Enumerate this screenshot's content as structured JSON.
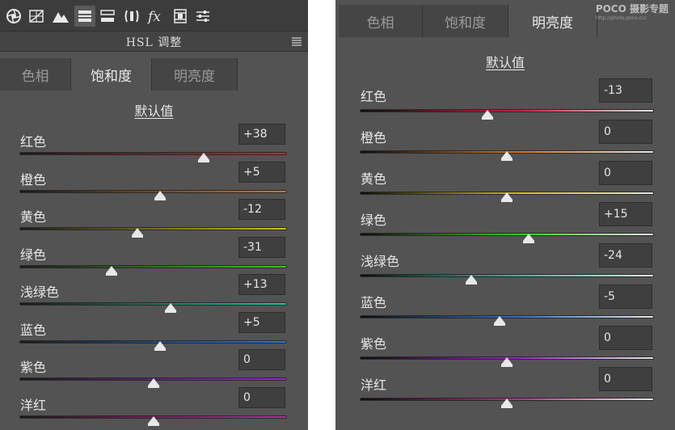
{
  "left": {
    "title": "HSL 调整",
    "tabs": [
      "色相",
      "饱和度",
      "明亮度"
    ],
    "active_tab": 1,
    "default_label": "默认值",
    "rows": [
      {
        "label": "红色",
        "value": "+38",
        "fraction": 0.69
      },
      {
        "label": "橙色",
        "value": "+5",
        "fraction": 0.525
      },
      {
        "label": "黄色",
        "value": "-12",
        "fraction": 0.44
      },
      {
        "label": "绿色",
        "value": "-31",
        "fraction": 0.345
      },
      {
        "label": "浅绿色",
        "value": "+13",
        "fraction": 0.565
      },
      {
        "label": "蓝色",
        "value": "+5",
        "fraction": 0.525
      },
      {
        "label": "紫色",
        "value": "0",
        "fraction": 0.5
      },
      {
        "label": "洋红",
        "value": "0",
        "fraction": 0.5
      }
    ]
  },
  "right": {
    "tabs": [
      "色相",
      "饱和度",
      "明亮度"
    ],
    "active_tab": 2,
    "logo_line1": "POCO 摄影专题",
    "logo_line2": "http://photo.poco.cn/",
    "default_label": "默认值",
    "rows": [
      {
        "label": "红色",
        "value": "-13",
        "fraction": 0.435
      },
      {
        "label": "橙色",
        "value": "0",
        "fraction": 0.5
      },
      {
        "label": "黄色",
        "value": "0",
        "fraction": 0.5
      },
      {
        "label": "绿色",
        "value": "+15",
        "fraction": 0.575
      },
      {
        "label": "浅绿色",
        "value": "-24",
        "fraction": 0.38
      },
      {
        "label": "蓝色",
        "value": "-5",
        "fraction": 0.475
      },
      {
        "label": "紫色",
        "value": "0",
        "fraction": 0.5
      },
      {
        "label": "洋红",
        "value": "0",
        "fraction": 0.5
      }
    ]
  },
  "colors": {
    "panel_bg": "#535353",
    "track_red": "#c8243c",
    "track_orange": "#d9731e",
    "track_yellow": "#cfc21a",
    "track_green": "#3ec81e",
    "track_aqua": "#22c6a0",
    "track_blue": "#2d74d2",
    "track_purple": "#9a28c8",
    "track_magenta": "#c82896"
  },
  "toolbar_icons": [
    "aperture-icon",
    "grid-curve-icon",
    "mountain-icon",
    "hsl-icon",
    "split-tone-icon",
    "lens-icon",
    "fx-icon",
    "camera-calibration-icon",
    "presets-icon"
  ]
}
